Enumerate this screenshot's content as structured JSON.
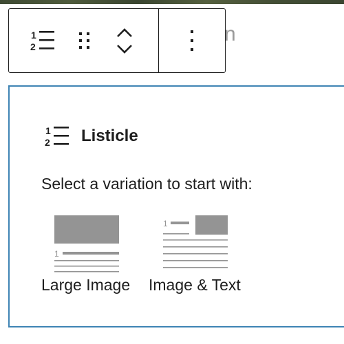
{
  "background_text": "n",
  "toolbar": {
    "block_type_icon": "ordered-list-icon",
    "drag_icon": "drag-handle-icon",
    "move_up_icon": "chevron-up-icon",
    "move_down_icon": "chevron-down-icon",
    "more_icon": "more-vertical-icon"
  },
  "placeholder": {
    "icon": "ordered-list-icon",
    "title": "Listicle",
    "instructions": "Select a variation to start with:",
    "border_color": "#3e84b4",
    "variations": [
      {
        "label": "Large Image",
        "icon": "large-image-variation-icon",
        "number": "1"
      },
      {
        "label": "Image & Text",
        "icon": "image-text-variation-icon",
        "number": "1"
      }
    ]
  }
}
